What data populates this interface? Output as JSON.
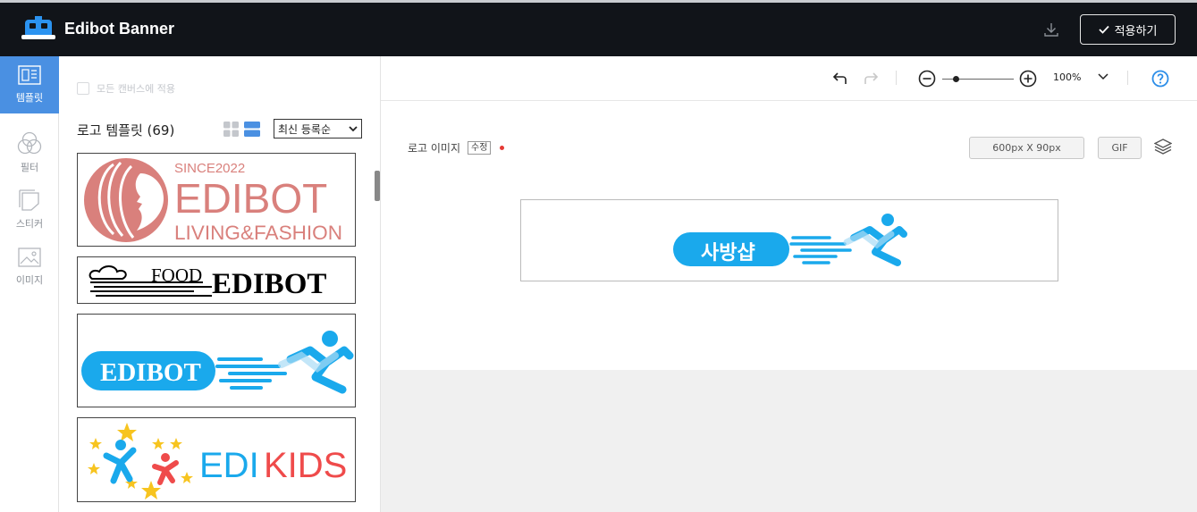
{
  "app": {
    "title": "Edibot Banner",
    "apply_label": "적용하기"
  },
  "sidebar": {
    "items": [
      {
        "label": "템플릿",
        "icon": "template-icon",
        "active": true
      },
      {
        "label": "필터",
        "icon": "filter-icon",
        "active": false
      },
      {
        "label": "스티커",
        "icon": "sticker-icon",
        "active": false
      },
      {
        "label": "이미지",
        "icon": "image-icon",
        "active": false
      }
    ]
  },
  "panel": {
    "apply_all_label": "모든 캔버스에 적용",
    "section_title": "로고 템플릿 (69)",
    "sort_value": "최신 등록순",
    "templates": [
      {
        "since": "SINCE2022",
        "name": "EDIBOT",
        "sub": "LIVING&FASHION"
      },
      {
        "food": "FOOD",
        "name": "EDIBOT"
      },
      {
        "name": "EDIBOT"
      },
      {
        "edi": "EDI",
        "kids": "KIDS"
      }
    ]
  },
  "toolbar": {
    "zoom": "100%"
  },
  "canvas": {
    "label": "로고 이미지",
    "edit_label": "수정",
    "size": "600px X 90px",
    "format": "GIF",
    "banner_text": "사방샵"
  },
  "colors": {
    "topbar": "#111419",
    "accent": "#4a90e2",
    "logo_blue": "#1aa9ec",
    "pink": "#d9807c"
  }
}
